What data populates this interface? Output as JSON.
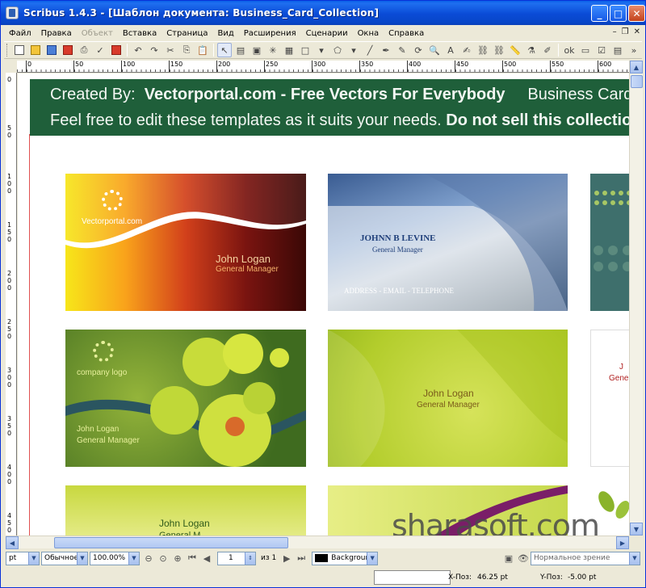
{
  "window": {
    "title": "Scribus 1.4.3 - [Шаблон документа: Business_Card_Collection]",
    "min": "_",
    "max": "□",
    "close": "✕"
  },
  "menu": {
    "items": [
      "Файл",
      "Правка",
      "Объект",
      "Вставка",
      "Страница",
      "Вид",
      "Расширения",
      "Сценарии",
      "Окна",
      "Справка"
    ],
    "disabled_item": "Объект"
  },
  "ruler": {
    "h_labels": [
      "0",
      "50",
      "100",
      "150",
      "200",
      "250",
      "300",
      "350",
      "400",
      "450",
      "500",
      "550",
      "600"
    ],
    "v_labels": [
      "0",
      "50",
      "100",
      "150",
      "200",
      "250",
      "300",
      "350",
      "400",
      "450"
    ]
  },
  "banner": {
    "line1_prefix": "Created By:",
    "line1_bold": "Vectorportal.com - Free Vectors For Everybody",
    "line1_suffix": "Business Card Fo",
    "line2_prefix": "Feel free to edit these templates as it suits your needs.",
    "line2_bold": "Do not sell this collection"
  },
  "cards": {
    "c1": {
      "logo_text": "Vectorportal.com",
      "name": "John Logan",
      "role": "General Manager"
    },
    "c2": {
      "name": "JOHNN B LEVINE",
      "role": "General Manager",
      "contact": "ADDRESS - EMAIL - TELEPHONE"
    },
    "c4": {
      "logo_text": "company logo",
      "name": "John Logan",
      "role": "General Manager"
    },
    "c5": {
      "name": "John Logan",
      "role": "General Manager"
    },
    "c6": {
      "name": "J",
      "role": "Gene"
    },
    "c7": {
      "name": "John Logan",
      "role": "General M"
    }
  },
  "watermark": "sharasoft.com",
  "bottom": {
    "unit": "pt",
    "quality": "Обычное",
    "zoom": "100.00%",
    "page_current": "1",
    "page_total_label": "из 1",
    "layer": "Background",
    "view_mode": "Нормальное зрение"
  },
  "status": {
    "x_label": "X-Поз:",
    "x_value": "46.25 pt",
    "y_label": "Y-Поз:",
    "y_value": "-5.00 pt"
  }
}
